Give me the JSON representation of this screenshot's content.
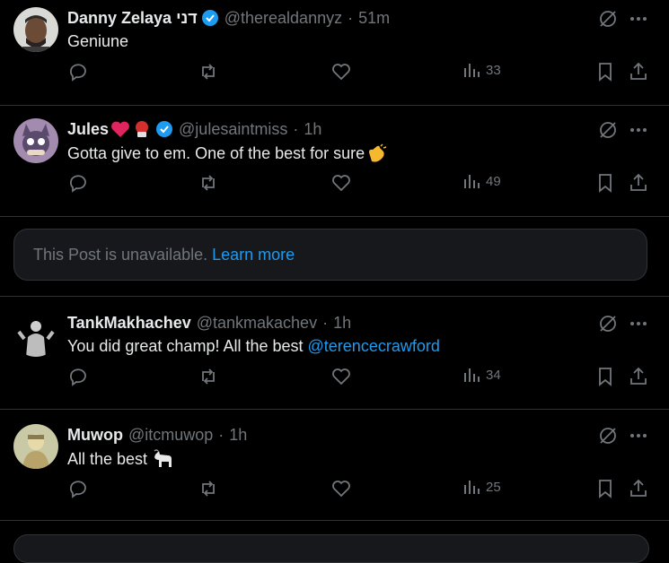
{
  "posts": [
    {
      "name": "Danny Zelaya דני",
      "handle": "@therealdannyz",
      "separator": "·",
      "time": "51m",
      "verified": true,
      "text": "Geniune",
      "views": "33"
    },
    {
      "name": "Jules",
      "name_emojis": [
        "red-heart-icon",
        "boxing-glove-icon"
      ],
      "handle": "@julesaintmiss",
      "separator": "·",
      "time": "1h",
      "verified": true,
      "text": "Gotta give to em. One of the best for sure",
      "text_emoji": "clapping-hands-icon",
      "views": "49"
    },
    {
      "name": "TankMakhachev",
      "handle": "@tankmakachev",
      "separator": "·",
      "time": "1h",
      "verified": false,
      "text": "You did great champ! All the best",
      "mention": "@terencecrawford",
      "views": "34"
    },
    {
      "name": "Muwop",
      "handle": "@itcmuwop",
      "separator": "·",
      "time": "1h",
      "verified": false,
      "text": "All the best",
      "text_emoji": "goat-icon",
      "views": "25"
    }
  ],
  "unavailable": {
    "text": "This Post is unavailable.",
    "link": "Learn more"
  },
  "icons": [
    "reply-icon",
    "repost-icon",
    "like-icon",
    "views-icon",
    "bookmark-icon",
    "share-icon",
    "grok-icon",
    "more-icon",
    "verified-badge-icon"
  ],
  "colors": {
    "background": "#000000",
    "text": "#e7e9ea",
    "muted": "#71767b",
    "accent": "#1d9bf0",
    "border": "#2f3336",
    "verified": "#1d9bf0"
  }
}
